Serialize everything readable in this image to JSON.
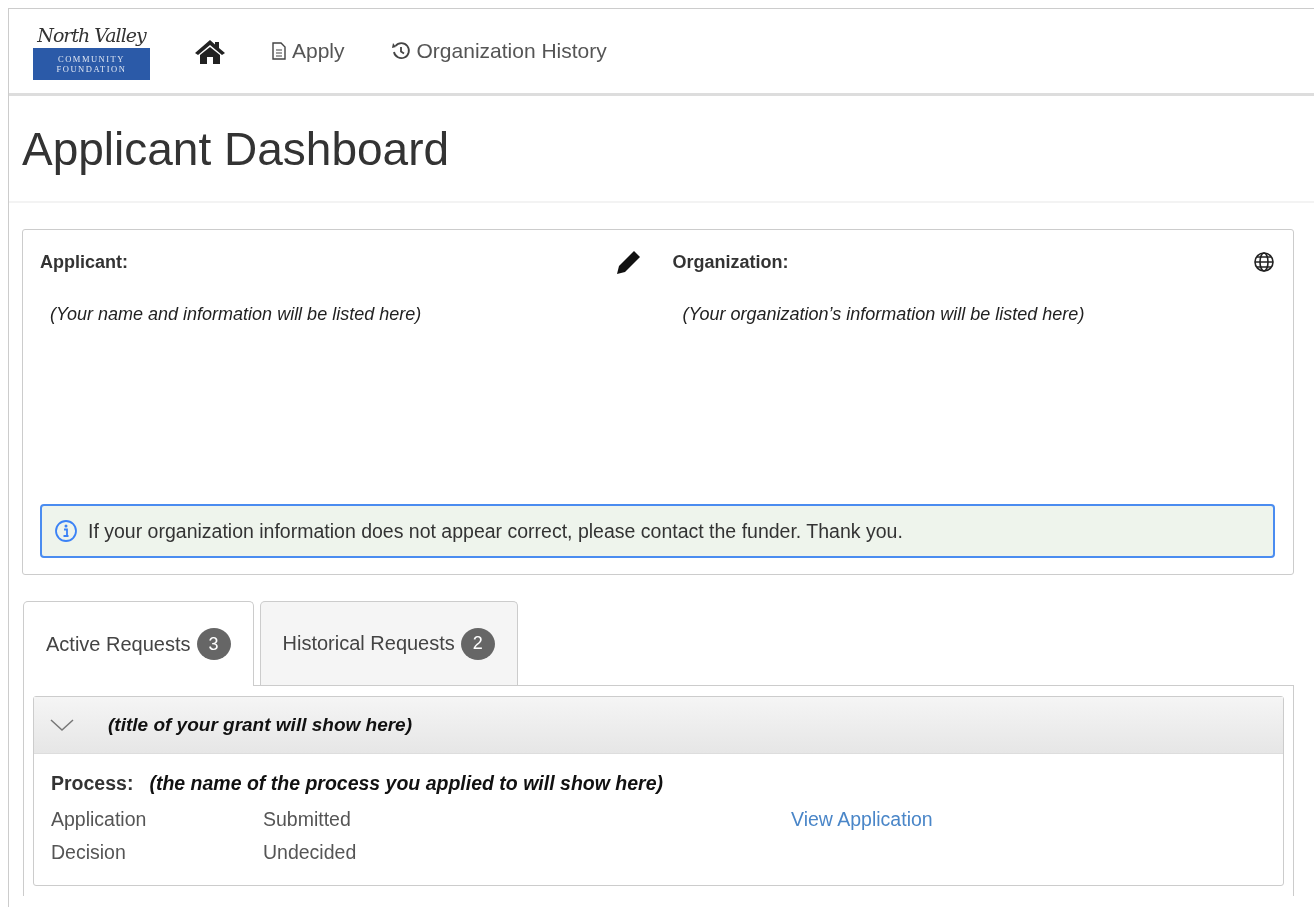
{
  "logo": {
    "script": "North Valley",
    "line_1": "COMMUNITY",
    "line_2": "FOUNDATION"
  },
  "nav": [
    {
      "kind": "home"
    },
    {
      "kind": "document",
      "label": "Apply"
    },
    {
      "kind": "history",
      "label": "Organization History"
    }
  ],
  "page_title": "Applicant Dashboard",
  "applicant": {
    "heading": "Applicant:",
    "info": "(Your name and information will be listed here)"
  },
  "organization": {
    "heading": "Organization:",
    "info": "(Your organization’s information will be listed here)"
  },
  "notice": "If your organization information does not appear correct, please contact the funder. Thank you.",
  "tabs": [
    {
      "label": "Active Requests",
      "count": "3",
      "selected": true
    },
    {
      "label": "Historical Requests",
      "count": "2",
      "selected": false
    }
  ],
  "request": {
    "title": "(title of your grant will show here)",
    "expanded": true,
    "process_label": "Process:",
    "process": "(the name of the process you applied to will show here)",
    "rows": [
      {
        "label": "Application",
        "status": "Submitted",
        "link": "View Application"
      },
      {
        "label": "Decision",
        "status": "Undecided"
      }
    ]
  }
}
